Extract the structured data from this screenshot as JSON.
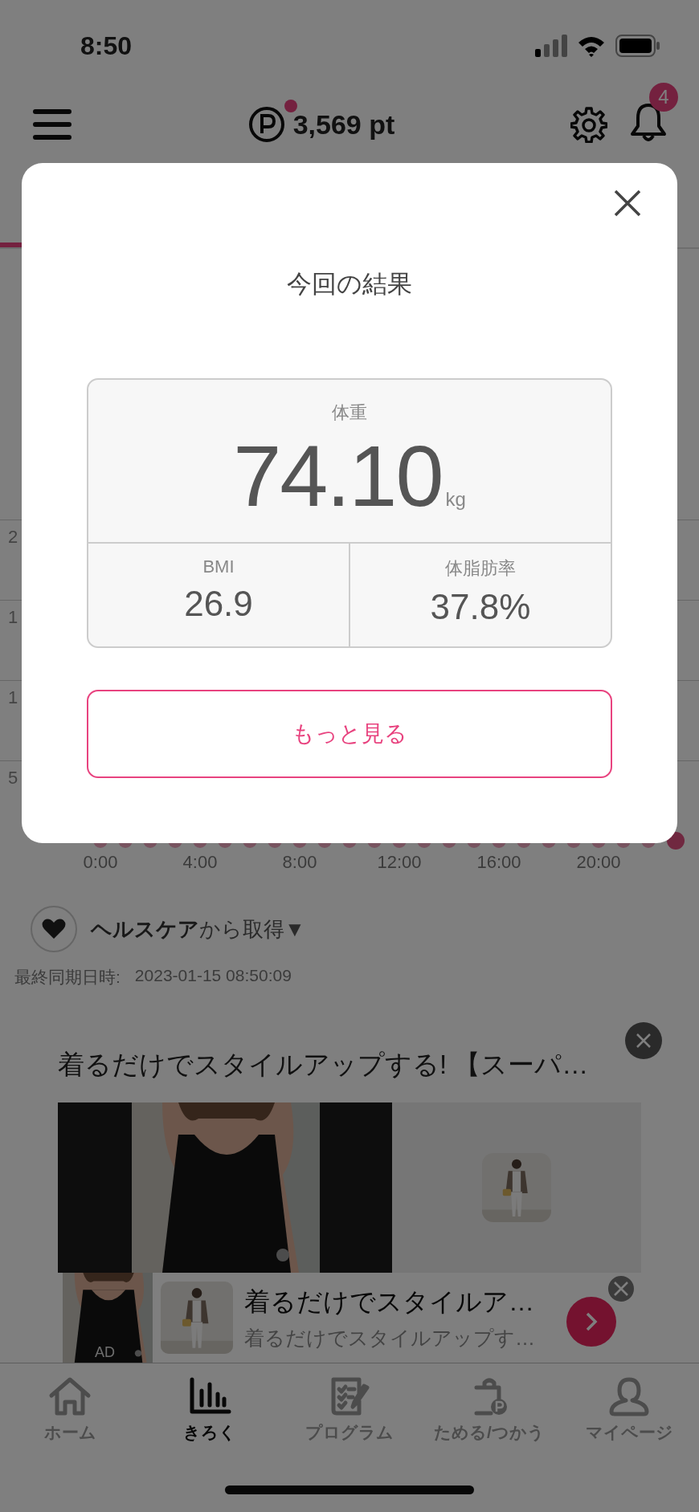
{
  "status_bar": {
    "time": "8:50"
  },
  "header": {
    "points": "3,569 pt",
    "points_new": true,
    "notification_count": "4"
  },
  "chart": {
    "y_labels": [
      "2",
      "1",
      "1",
      "5"
    ],
    "x_labels": [
      "0:00",
      "4:00",
      "8:00",
      "12:00",
      "16:00",
      "20:00"
    ]
  },
  "healthcare": {
    "label": "**ヘルスケア**から取得▼"
  },
  "sync": {
    "label": "最終同期日時:",
    "value": "2023-01-15 08:50:09"
  },
  "ad": {
    "title": "着るだけでスタイルアップする! 【スーパ…",
    "card_title": "着るだけでスタイルア…",
    "card_subtitle": "着るだけでスタイルアップす…",
    "ad_label": "AD"
  },
  "modal": {
    "title": "今回の結果",
    "weight": {
      "label": "体重",
      "value": "74.10",
      "unit": "kg"
    },
    "metrics": [
      {
        "label": "BMI",
        "value": "26.9"
      },
      {
        "label": "体脂肪率",
        "value": "37.8%"
      }
    ],
    "button": "もっと見る"
  },
  "tabs": [
    {
      "label": "ホーム",
      "kind": "home",
      "selected": false
    },
    {
      "label": "きろく",
      "kind": "record",
      "selected": true
    },
    {
      "label": "プログラム",
      "kind": "program",
      "selected": false
    },
    {
      "label": "ためる/つかう",
      "kind": "points",
      "selected": false
    },
    {
      "label": "マイページ",
      "kind": "mypage",
      "selected": false
    }
  ]
}
